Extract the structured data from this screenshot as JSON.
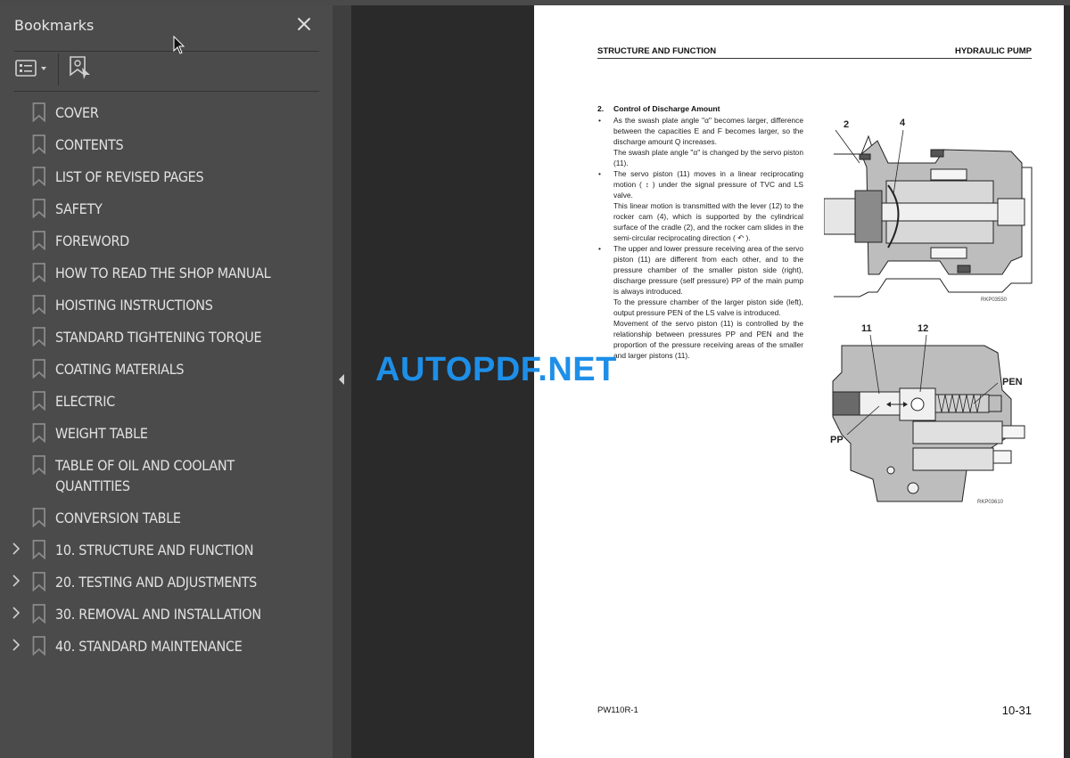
{
  "sidebar": {
    "title": "Bookmarks",
    "close_icon": "close-icon",
    "toolbar": {
      "options_icon": "list-options-icon",
      "find_icon": "find-current-bookmark-icon"
    },
    "items": [
      {
        "label": "COVER",
        "expandable": false
      },
      {
        "label": "CONTENTS",
        "expandable": false
      },
      {
        "label": "LIST OF REVISED PAGES",
        "expandable": false
      },
      {
        "label": "SAFETY",
        "expandable": false
      },
      {
        "label": "FOREWORD",
        "expandable": false
      },
      {
        "label": "HOW TO READ THE SHOP MANUAL",
        "expandable": false
      },
      {
        "label": "HOISTING INSTRUCTIONS",
        "expandable": false
      },
      {
        "label": "STANDARD TIGHTENING TORQUE",
        "expandable": false
      },
      {
        "label": "COATING MATERIALS",
        "expandable": false
      },
      {
        "label": "ELECTRIC",
        "expandable": false
      },
      {
        "label": "WEIGHT TABLE",
        "expandable": false
      },
      {
        "label": "TABLE OF OIL AND COOLANT QUANTITIES",
        "expandable": false
      },
      {
        "label": "CONVERSION TABLE",
        "expandable": false
      },
      {
        "label": "10. STRUCTURE AND FUNCTION",
        "expandable": true
      },
      {
        "label": "20. TESTING AND ADJUSTMENTS",
        "expandable": true
      },
      {
        "label": "30. REMOVAL AND INSTALLATION",
        "expandable": true
      },
      {
        "label": "40. STANDARD MAINTENANCE",
        "expandable": true
      }
    ]
  },
  "watermark": "AUTOPDF.NET",
  "page": {
    "header_left": "STRUCTURE AND FUNCTION",
    "header_right": "HYDRAULIC PUMP",
    "section_number": "2.",
    "section_title": "Control of Discharge Amount",
    "bullets": [
      {
        "paragraphs": [
          "As the swash plate angle \"α\" becomes larger, difference between the capacities E and F becomes larger, so the discharge amount Q increases.",
          "The swash plate angle \"α\" is changed by the servo piston (11)."
        ]
      },
      {
        "paragraphs": [
          "The servo piston (11) moves in a linear reciprocating motion ( ↕ ) under the signal pressure of TVC and LS valve.",
          "This linear motion is transmitted with the lever (12) to the rocker cam (4), which is supported by the cylindrical surface of the cradle (2), and the rocker cam slides in the semi-circular reciprocating direction ( ↶ )."
        ]
      },
      {
        "paragraphs": [
          "The upper and lower pressure receiving area of the servo piston (11) are different from each other, and to the pressure chamber of the smaller piston side (right), discharge pressure (self pressure) PP of the main pump is always introduced.",
          "To the pressure chamber of the larger piston side (left), output pressure PEN of the LS valve is introduced.",
          "Movement of the servo piston (11) is controlled by the relationship between pressures PP and PEN and the proportion of the pressure receiving areas of the smaller and larger pistons (11)."
        ]
      }
    ],
    "figure1": {
      "labels": [
        "2",
        "4"
      ],
      "code": "RKP03550"
    },
    "figure2": {
      "labels": [
        "11",
        "12",
        "PEN",
        "PP"
      ],
      "code": "RKP03610"
    },
    "footer_left": "PW110R-1",
    "footer_right": "10-31"
  }
}
